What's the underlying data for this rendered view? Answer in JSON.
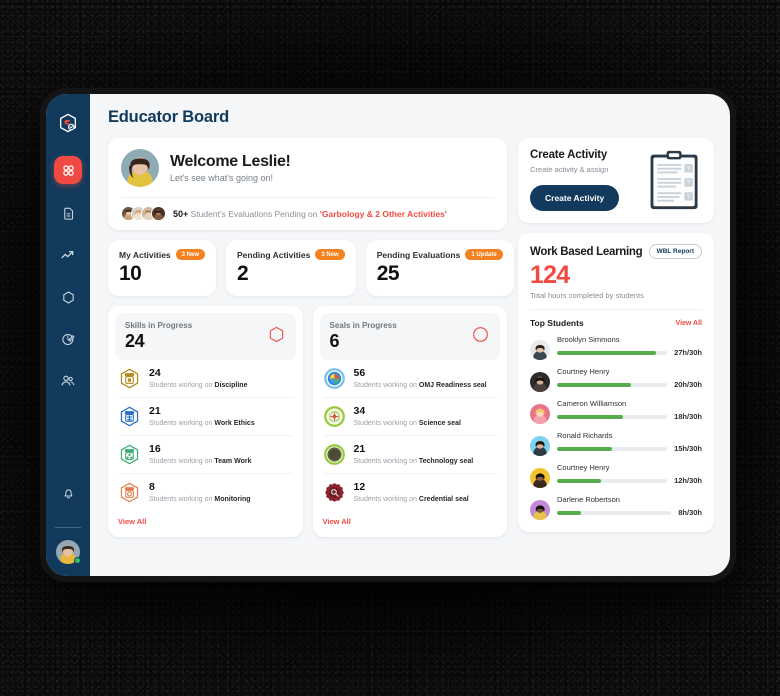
{
  "app": {
    "page_title": "Educator Board",
    "accent_red": "#ef4b42",
    "accent_navy": "#123a5c",
    "accent_orange": "#f58220",
    "accent_green": "#56ab4d"
  },
  "sidebar": {
    "items": [
      {
        "icon": "hexagon-badge-logo-icon",
        "label": "Logo"
      },
      {
        "icon": "dashboard-grid-icon",
        "label": "Dashboard",
        "active": true
      },
      {
        "icon": "document-icon",
        "label": "Documents"
      },
      {
        "icon": "trending-up-icon",
        "label": "Analytics"
      },
      {
        "icon": "hexagon-outline-icon",
        "label": "Skills"
      },
      {
        "icon": "badge-edit-icon",
        "label": "Activities"
      },
      {
        "icon": "users-icon",
        "label": "Students"
      }
    ],
    "bottom": [
      {
        "icon": "bell-icon",
        "label": "Notifications"
      }
    ],
    "profile": {
      "icon": "avatar",
      "label": "Profile",
      "status": "online"
    }
  },
  "welcome": {
    "avatar": "leslie-avatar",
    "title": "Welcome Leslie!",
    "subtitle": "Let's see what's going on!",
    "pending_count": "50+",
    "pending_text": "Student's Evaluations Pending on",
    "pending_link": "'Garbology & 2 Other Activities'",
    "avatar_stack": [
      "student-avatar-1",
      "student-avatar-2",
      "student-avatar-3",
      "student-avatar-4"
    ]
  },
  "stats": [
    {
      "label": "My Activities",
      "badge": "3 New",
      "value": "10"
    },
    {
      "label": "Pending Activities",
      "badge": "3 New",
      "value": "2"
    },
    {
      "label": "Pending Evaluations",
      "badge": "1 Update",
      "value": "25"
    }
  ],
  "skills_card": {
    "head_label": "Skills in Progress",
    "head_value": "24",
    "head_icon": "hexagon-outline-icon",
    "view_all": "View All",
    "items": [
      {
        "count": "24",
        "prefix": "Students working on",
        "name": "Discipline",
        "badge_icon": "skill-hexagon-badge-icon",
        "color": "#b08a1e"
      },
      {
        "count": "21",
        "prefix": "Students working on",
        "name": "Work Ethics",
        "badge_icon": "skill-hexagon-badge-icon",
        "color": "#2b6fc4"
      },
      {
        "count": "16",
        "prefix": "Students working on",
        "name": "Team Work",
        "badge_icon": "skill-hexagon-badge-icon",
        "color": "#3fab78"
      },
      {
        "count": "8",
        "prefix": "Students working on",
        "name": "Monitoring",
        "badge_icon": "skill-hexagon-badge-icon",
        "color": "#e08050"
      }
    ]
  },
  "seals_card": {
    "head_label": "Seals in Progress",
    "head_value": "6",
    "head_icon": "circle-outline-icon",
    "view_all": "View All",
    "items": [
      {
        "count": "56",
        "prefix": "Students working on",
        "name": "OMJ Readiness seal",
        "badge_icon": "seal-circle-badge-icon",
        "color": "#2b87d6"
      },
      {
        "count": "34",
        "prefix": "Students working on",
        "name": "Science seal",
        "badge_icon": "seal-circle-badge-icon",
        "color": "#9ac93a"
      },
      {
        "count": "21",
        "prefix": "Students working on",
        "name": "Technology seal",
        "badge_icon": "seal-circle-badge-icon",
        "color": "#5a5c32"
      },
      {
        "count": "12",
        "prefix": "Students working on",
        "name": "Credential seal",
        "badge_icon": "seal-circle-badge-icon",
        "color": "#8c2430"
      }
    ]
  },
  "create_activity": {
    "title": "Create Activity",
    "subtitle": "Create activity & assign",
    "button_label": "Create Activity",
    "illustration": "clipboard-icon"
  },
  "wbl": {
    "title": "Work Based Learning",
    "report_label": "WBL Report",
    "value": "124",
    "caption": "Total hours completed by students"
  },
  "top_students": {
    "title": "Top Students",
    "view_all": "View All",
    "items": [
      {
        "name": "Brooklyn Simmons",
        "hours": "27h/30h",
        "percent": 90,
        "avatar_bg": "#e6eaec"
      },
      {
        "name": "Courtney Henry",
        "hours": "20h/30h",
        "percent": 67,
        "avatar_bg": "#2b2b2b"
      },
      {
        "name": "Cameron Williamson",
        "hours": "18h/30h",
        "percent": 60,
        "avatar_bg": "#e8748a"
      },
      {
        "name": "Ronald Richards",
        "hours": "15h/30h",
        "percent": 50,
        "avatar_bg": "#7cd3ef"
      },
      {
        "name": "Courtney Henry",
        "hours": "12h/30h",
        "percent": 40,
        "avatar_bg": "#f2c230"
      },
      {
        "name": "Darlene Robertson",
        "hours": "8h/30h",
        "percent": 21,
        "avatar_bg": "#c48ad8"
      }
    ]
  }
}
